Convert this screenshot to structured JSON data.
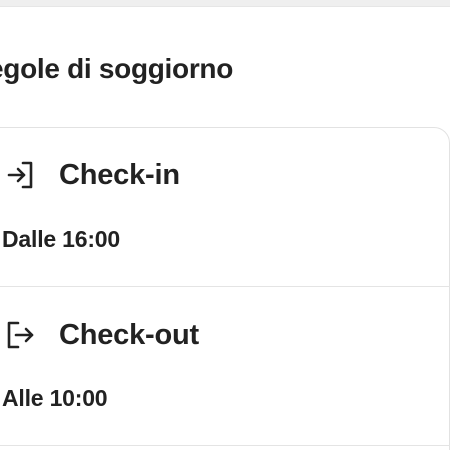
{
  "section": {
    "title": "egole di soggiorno"
  },
  "rules": [
    {
      "icon": "check-in-icon",
      "title": "Check-in",
      "value": "Dalle 16:00"
    },
    {
      "icon": "check-out-icon",
      "title": "Check-out",
      "value": "Alle 10:00"
    }
  ],
  "colors": {
    "text": "#222222",
    "border": "#e2e2e2",
    "background": "#ffffff"
  }
}
